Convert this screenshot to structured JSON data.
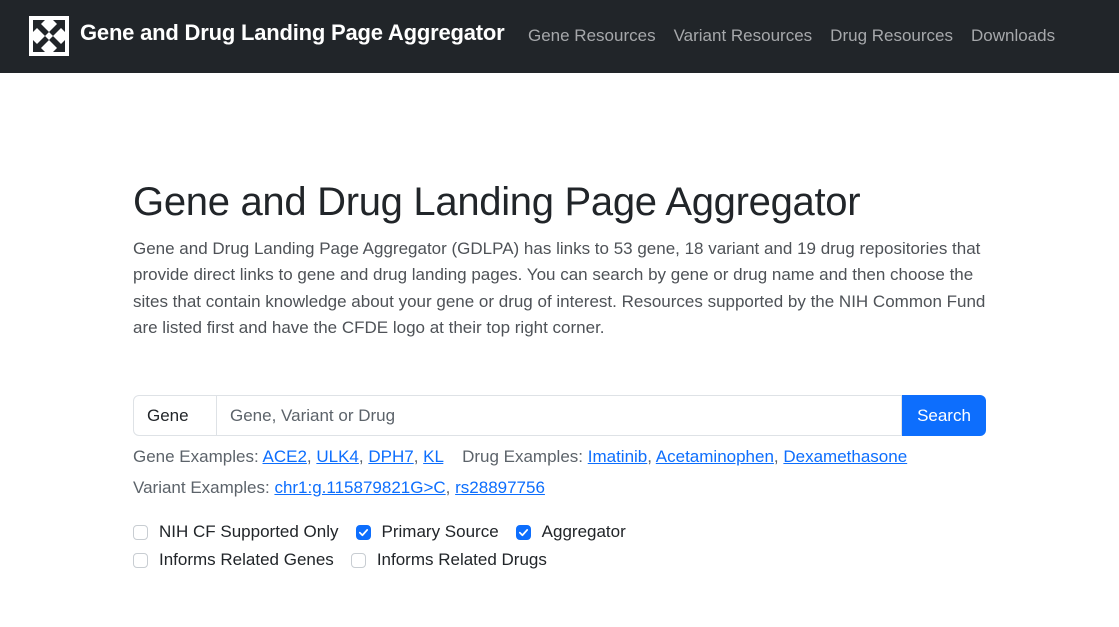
{
  "navbar": {
    "brand_title": "Gene and Drug Landing Page Aggregator",
    "links": [
      "Gene Resources",
      "Variant Resources",
      "Drug Resources",
      "Downloads"
    ]
  },
  "main": {
    "heading": "Gene and Drug Landing Page Aggregator",
    "intro": "Gene and Drug Landing Page Aggregator (GDLPA) has links to 53 gene, 18 variant and 19 drug repositories that provide direct links to gene and drug landing pages. You can search by gene or drug name and then choose the sites that contain knowledge about your gene or drug of interest. Resources supported by the NIH Common Fund are listed first and have the CFDE logo at their top right corner.",
    "search": {
      "type_value": "Gene",
      "placeholder": "Gene, Variant or Drug",
      "value": "",
      "button_label": "Search"
    },
    "gene_examples": {
      "label": "Gene Examples:",
      "items": [
        "ACE2",
        "ULK4",
        "DPH7",
        "KL"
      ]
    },
    "drug_examples": {
      "label": "Drug Examples:",
      "items": [
        "Imatinib",
        "Acetaminophen",
        "Dexamethasone"
      ]
    },
    "variant_examples": {
      "label": "Variant Examples:",
      "items": [
        "chr1:g.115879821G>C",
        "rs28897756"
      ]
    },
    "filters": [
      {
        "label": "NIH CF Supported Only",
        "checked": false
      },
      {
        "label": "Primary Source",
        "checked": true
      },
      {
        "label": "Aggregator",
        "checked": true
      },
      {
        "label": "Informs Related Genes",
        "checked": false
      },
      {
        "label": "Informs Related Drugs",
        "checked": false
      }
    ],
    "colors": {
      "accent": "#0d6efd",
      "navbar": "#212529"
    }
  }
}
